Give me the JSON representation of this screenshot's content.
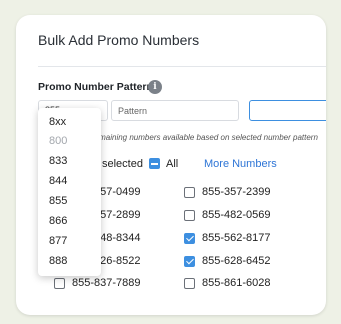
{
  "dialog": {
    "title": "Bulk Add Promo Numbers",
    "section_label": "Promo Number Pattern",
    "info_glyph": "i",
    "prefix_value": "855",
    "pattern_placeholder": "Pattern",
    "hint": "remaining numbers available based on selected number pattern",
    "selected_text": "selected",
    "all_label": "All",
    "more_label": "More Numbers"
  },
  "dropdown": {
    "options": [
      {
        "label": "8xx",
        "disabled": false
      },
      {
        "label": "800",
        "disabled": true
      },
      {
        "label": "833",
        "disabled": false
      },
      {
        "label": "844",
        "disabled": false
      },
      {
        "label": "855",
        "disabled": false
      },
      {
        "label": "866",
        "disabled": false
      },
      {
        "label": "877",
        "disabled": false
      },
      {
        "label": "888",
        "disabled": false
      }
    ]
  },
  "numbers": {
    "left": [
      {
        "number": "855-357-0499",
        "checked": false
      },
      {
        "number": "855-357-2899",
        "checked": false
      },
      {
        "number": "855-448-8344",
        "checked": false
      },
      {
        "number": "855-426-8522",
        "checked": false
      },
      {
        "number": "855-837-7889",
        "checked": false
      }
    ],
    "right": [
      {
        "number": "855-357-2399",
        "checked": false
      },
      {
        "number": "855-482-0569",
        "checked": false
      },
      {
        "number": "855-562-8177",
        "checked": true
      },
      {
        "number": "855-628-6452",
        "checked": true
      },
      {
        "number": "855-861-6028",
        "checked": false
      }
    ]
  },
  "colors": {
    "accent": "#3d8fe0",
    "link": "#2e75d6",
    "background": "#eef1e6"
  }
}
